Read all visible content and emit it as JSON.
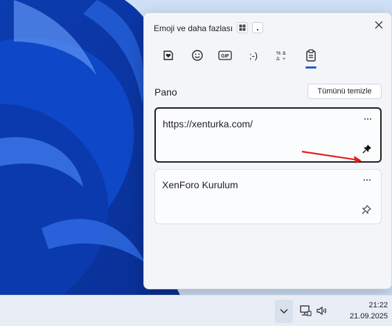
{
  "panel": {
    "title": "Emoji ve daha fazlası",
    "tabs": [
      {
        "name": "kaomoji-heart",
        "icon": "sticker-heart-icon"
      },
      {
        "name": "emoji",
        "icon": "smiley-icon"
      },
      {
        "name": "gif",
        "icon": "gif-icon",
        "text": "GIF"
      },
      {
        "name": "kaomoji",
        "icon": "kaomoji-icon",
        "text": ";-)"
      },
      {
        "name": "symbols",
        "icon": "symbols-icon"
      },
      {
        "name": "clipboard",
        "icon": "clipboard-icon",
        "selected": true
      }
    ],
    "section_title": "Pano",
    "clear_all": "Tümünü temizle",
    "items": [
      {
        "text": "https://xenturka.com/",
        "pinned": true,
        "selected": true
      },
      {
        "text": "XenForo Kurulum",
        "pinned": false,
        "selected": false
      }
    ]
  },
  "taskbar": {
    "time": "21:22",
    "date": "21.09.2025"
  },
  "colors": {
    "accent": "#1b5fc4",
    "annotation_arrow": "#e31b1b"
  }
}
